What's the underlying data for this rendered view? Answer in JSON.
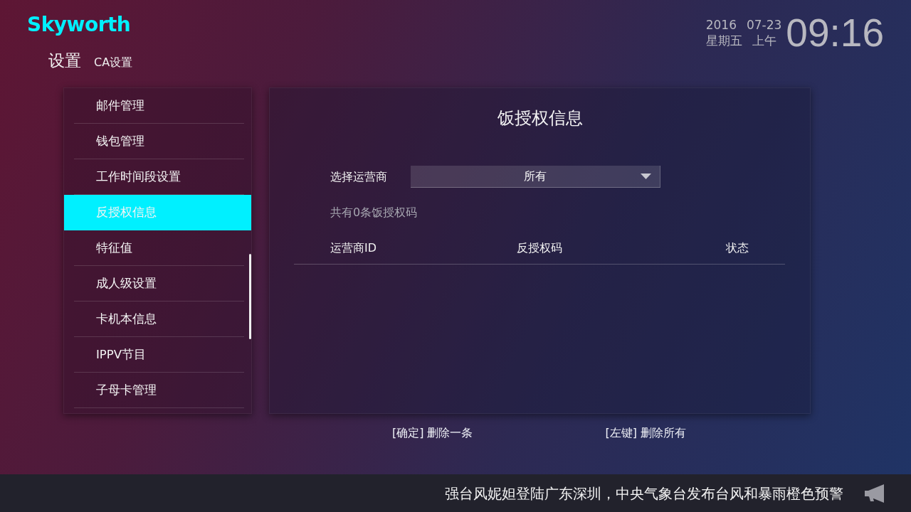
{
  "logo": "Skyworth",
  "breadcrumb": {
    "title": "设置",
    "subtitle": "CA设置"
  },
  "clock": {
    "year": "2016",
    "date": "07-23",
    "weekday": "星期五",
    "period": "上午",
    "time": "09:16"
  },
  "sidebar": {
    "items": [
      {
        "label": "邮件管理",
        "selected": false
      },
      {
        "label": "钱包管理",
        "selected": false
      },
      {
        "label": "工作时间段设置",
        "selected": false
      },
      {
        "label": "反授权信息",
        "selected": true
      },
      {
        "label": "特征值",
        "selected": false
      },
      {
        "label": "成人级设置",
        "selected": false
      },
      {
        "label": "卡机本信息",
        "selected": false
      },
      {
        "label": "IPPV节目",
        "selected": false
      },
      {
        "label": "子母卡管理",
        "selected": false
      }
    ]
  },
  "panel": {
    "title": "饭授权信息",
    "operator_select": {
      "label": "选择运营商",
      "value": "所有"
    },
    "summary": "共有0条饭授权码",
    "table": {
      "columns": [
        "运营商ID",
        "反授权码",
        "状态"
      ]
    }
  },
  "hints": [
    "[确定] 删除一条",
    "[左键] 删除所有"
  ],
  "ticker": {
    "text": "强台风妮妲登陆广东深圳，中央气象台发布台风和暴雨橙色预警"
  }
}
